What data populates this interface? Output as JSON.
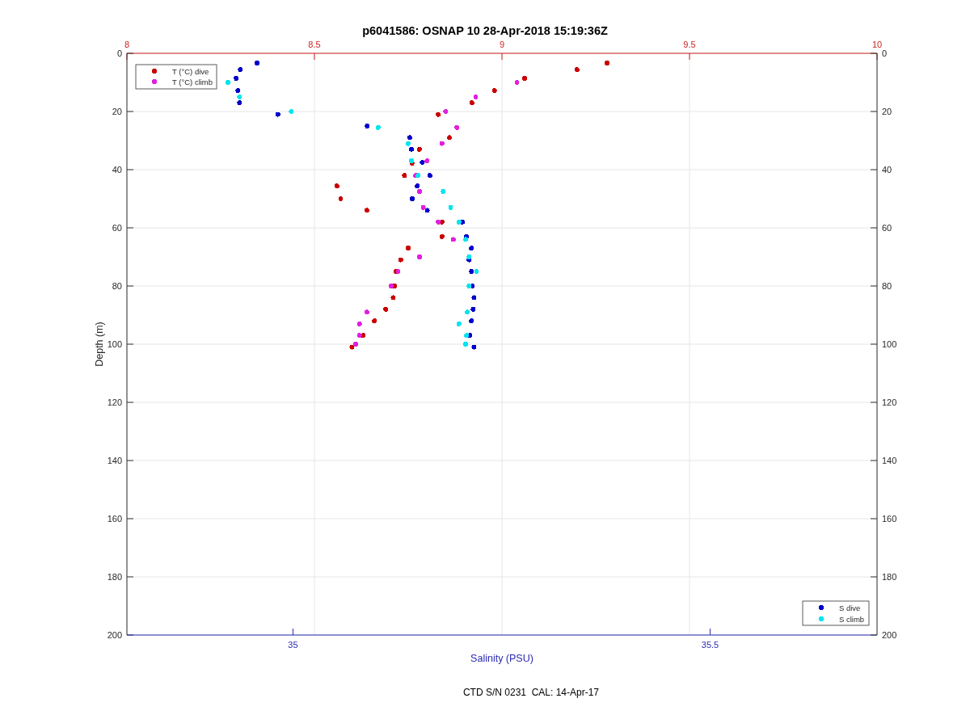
{
  "title": "p6041586: OSNAP 10 28-Apr-2018 15:19:36Z",
  "temperature_plot": {
    "chart_data": {
      "type": "scatter",
      "grid": true,
      "legend": true,
      "ylabel": "Depth (m)",
      "xlim": [
        8,
        10
      ],
      "ylim": [
        200,
        0
      ],
      "xticks": [
        8,
        8.5,
        9,
        9.5,
        10
      ],
      "yticks": [
        0,
        20,
        40,
        60,
        80,
        100,
        120,
        140,
        160,
        180,
        200
      ],
      "series": [
        {
          "name": "T (°C) dive",
          "color": "#cc0000",
          "x": [
            9.28,
            9.2,
            9.06,
            8.98,
            8.92,
            8.83,
            8.86,
            8.78,
            8.76,
            8.74,
            8.56,
            8.57,
            8.64,
            8.84,
            8.84,
            8.75,
            8.73,
            8.718,
            8.714,
            8.71,
            8.69,
            8.66,
            8.63,
            8.6
          ],
          "values": [
            3.3,
            5.6,
            8.6,
            12.8,
            17,
            21,
            29,
            33,
            37.8,
            42,
            45.6,
            50,
            54,
            58,
            63,
            67,
            71,
            75,
            80,
            84,
            88,
            92,
            97,
            101
          ]
        },
        {
          "name": "T (°C) climb",
          "color": "#e020e0",
          "x": [
            9.04,
            8.93,
            8.85,
            8.88,
            8.84,
            8.8,
            8.77,
            8.78,
            8.79,
            8.83,
            8.87,
            8.78,
            8.723,
            8.705,
            8.64,
            8.62,
            8.62,
            8.61
          ],
          "values": [
            10,
            15,
            20,
            25.5,
            31,
            37,
            42,
            47.5,
            53,
            58,
            64,
            70,
            75,
            80,
            89,
            93,
            97,
            100
          ]
        }
      ]
    }
  },
  "salinity_plot": {
    "chart_data": {
      "type": "scatter",
      "legend": true,
      "xlabel": "Salinity (PSU)",
      "xlim": [
        34.801,
        35.7
      ],
      "ylim": [
        200,
        0
      ],
      "xticks": [
        35,
        35.5
      ],
      "yticks": [
        0,
        20,
        40,
        60,
        80,
        100,
        120,
        140,
        160,
        180,
        200
      ],
      "series": [
        {
          "name": "S dive",
          "color": "#0000cc",
          "x": [
            34.957,
            34.937,
            34.932,
            34.934,
            34.936,
            34.982,
            35.089,
            35.14,
            35.142,
            35.155,
            35.164,
            35.149,
            35.143,
            35.161,
            35.203,
            35.208,
            35.214,
            35.211,
            35.214,
            35.215,
            35.217,
            35.216,
            35.214,
            35.212,
            35.217
          ],
          "values": [
            3.3,
            5.6,
            8.6,
            12.8,
            17,
            21,
            25,
            29,
            33,
            37.5,
            42,
            45.6,
            50,
            54,
            58,
            63,
            67,
            71,
            75,
            80,
            84,
            88,
            92,
            97,
            101
          ]
        },
        {
          "name": "S climb",
          "color": "#00e5ee",
          "x": [
            34.922,
            34.936,
            34.998,
            35.102,
            35.138,
            35.142,
            35.15,
            35.18,
            35.189,
            35.199,
            35.207,
            35.211,
            35.22,
            35.211,
            35.209,
            35.199,
            35.208,
            35.207
          ],
          "values": [
            10,
            15,
            20,
            25.5,
            31,
            37,
            42,
            47.5,
            53,
            58,
            64,
            70,
            75,
            80,
            89,
            93,
            97,
            100
          ]
        }
      ]
    }
  },
  "footer": "CTD S/N 0231  CAL: 14-Apr-17"
}
